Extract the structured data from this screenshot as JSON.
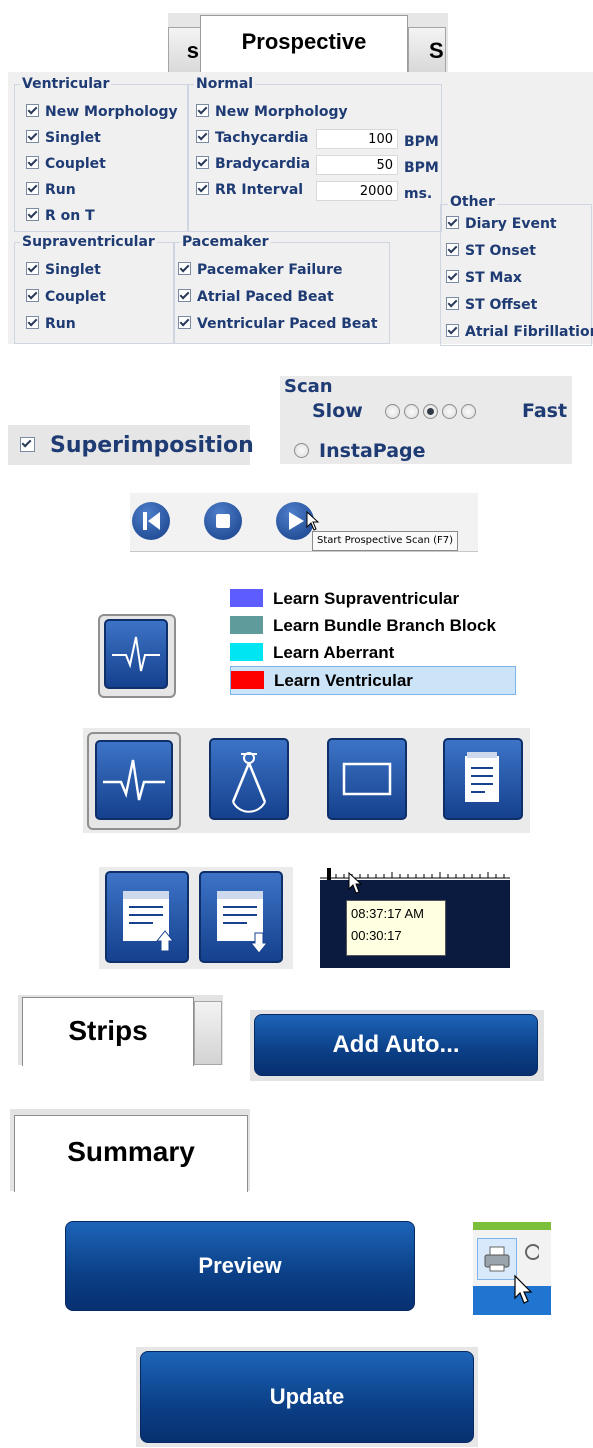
{
  "tabs": {
    "left_partial": "s",
    "active": "Prospective",
    "right_partial": "S"
  },
  "groups": {
    "ventricular": {
      "title": "Ventricular",
      "items": [
        "New Morphology",
        "Singlet",
        "Couplet",
        "Run",
        "R on T"
      ]
    },
    "normal": {
      "title": "Normal",
      "new_morphology": "New Morphology",
      "rates": [
        {
          "label": "Tachycardia",
          "value": "100",
          "unit": "BPM"
        },
        {
          "label": "Bradycardia",
          "value": "50",
          "unit": "BPM"
        },
        {
          "label": "RR Interval",
          "value": "2000",
          "unit": "ms."
        }
      ]
    },
    "supraventricular": {
      "title": "Supraventricular",
      "items": [
        "Singlet",
        "Couplet",
        "Run"
      ]
    },
    "pacemaker": {
      "title": "Pacemaker",
      "items": [
        "Pacemaker Failure",
        "Atrial Paced Beat",
        "Ventricular Paced Beat"
      ]
    },
    "other": {
      "title": "Other",
      "items": [
        "Diary Event",
        "ST Onset",
        "ST Max",
        "ST Offset",
        "Atrial Fibrillation"
      ]
    }
  },
  "superimposition": {
    "label": "Superimposition"
  },
  "scan": {
    "title": "Scan",
    "slow": "Slow",
    "fast": "Fast",
    "selected_index": 3,
    "instapage": "InstaPage"
  },
  "scan_controls": {
    "tooltip": "Start Prospective Scan (F7)"
  },
  "learn_menu": [
    {
      "label": "Learn Supraventricular",
      "color": "#5c5cff"
    },
    {
      "label": "Learn Bundle Branch Block",
      "color": "#5f9b9b"
    },
    {
      "label": "Learn Aberrant",
      "color": "#00e5f2"
    },
    {
      "label": "Learn Ventricular",
      "color": "#ff0000"
    }
  ],
  "time_tooltip": {
    "clock": "08:37:17 AM",
    "elapsed": "00:30:17"
  },
  "strips_tab": "Strips",
  "add_auto_button": "Add Auto...",
  "summary_tab": "Summary",
  "preview_button": "Preview",
  "update_button": "Update",
  "colors": {
    "accent": "#1f3b74",
    "button_blue": "#0b3f86",
    "highlight": "#cce4f7"
  }
}
